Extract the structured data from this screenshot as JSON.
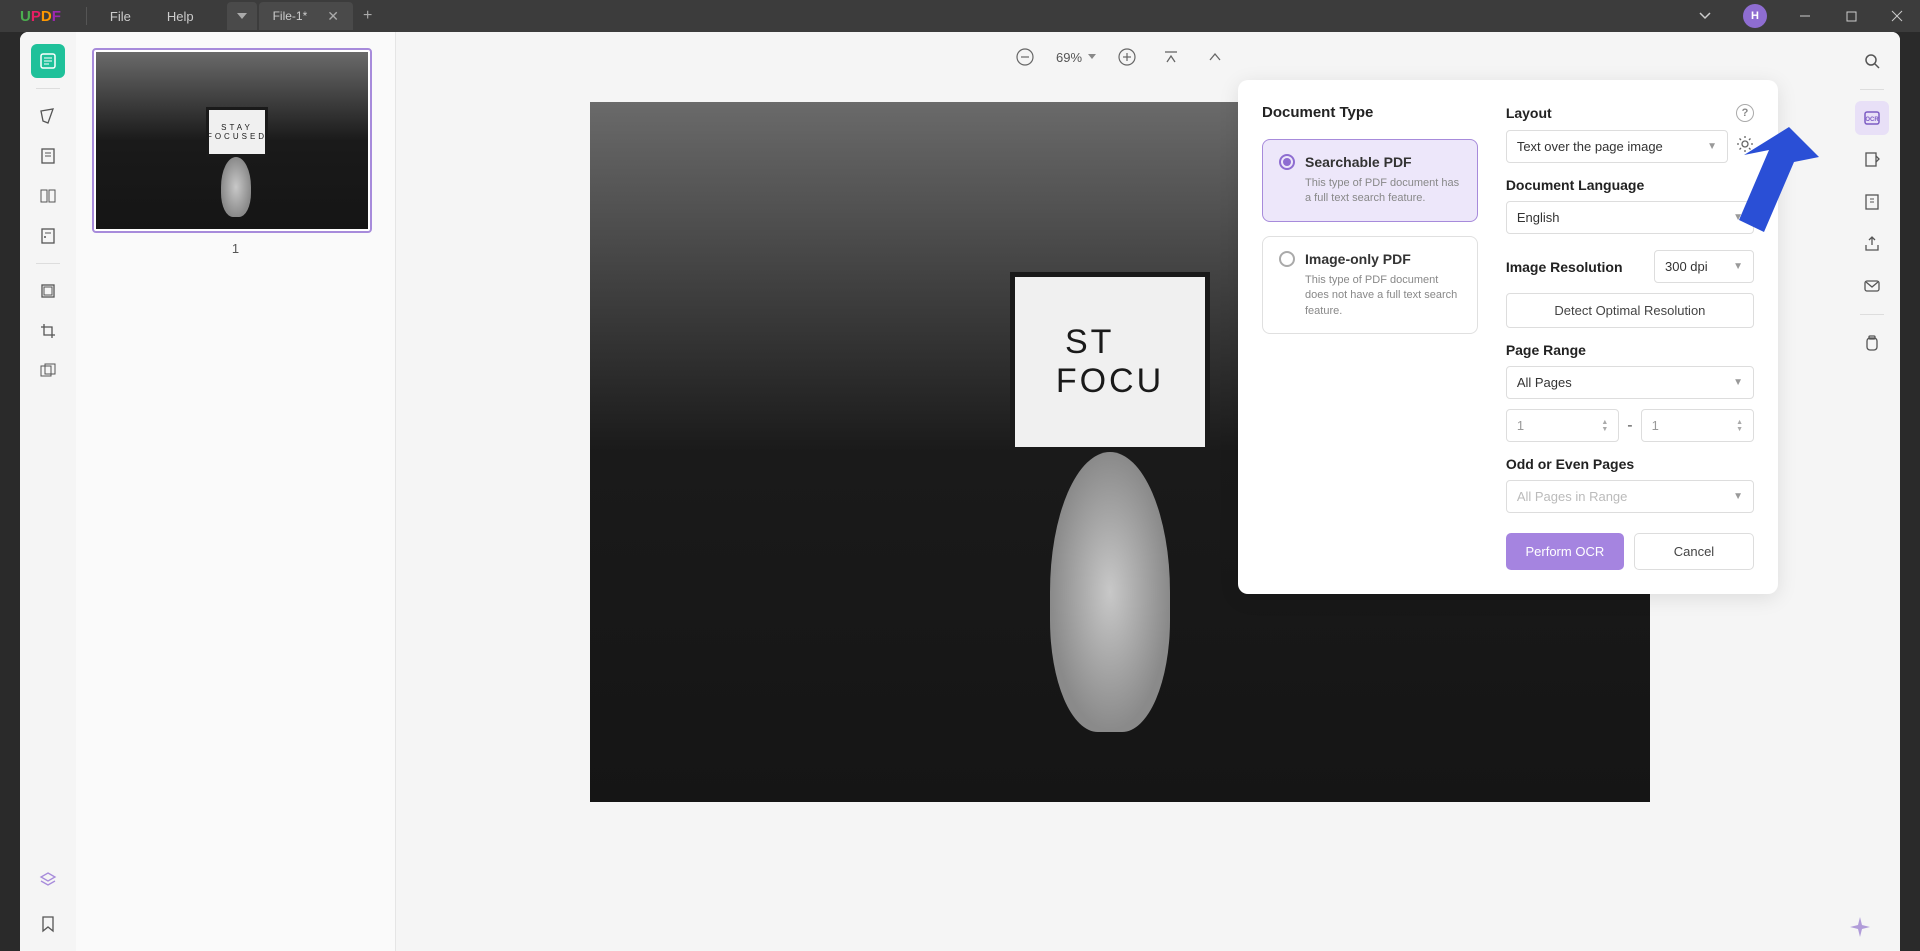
{
  "app": {
    "name": "UPDF"
  },
  "menu": {
    "file": "File",
    "help": "Help"
  },
  "tab": {
    "name": "File-1*"
  },
  "avatar": {
    "initial": "H"
  },
  "zoom": {
    "value": "69%"
  },
  "thumbnail": {
    "page_number": "1"
  },
  "page_content": {
    "line1": "STAY",
    "line2": "FOCUSED",
    "canvas_line1": "ST",
    "canvas_line2": "FOCU"
  },
  "ocr": {
    "document_type": {
      "title": "Document Type",
      "searchable": {
        "title": "Searchable PDF",
        "desc": "This type of PDF document has a full text search feature."
      },
      "imageonly": {
        "title": "Image-only PDF",
        "desc": "This type of PDF document does not have a full text search feature."
      }
    },
    "layout": {
      "label": "Layout",
      "value": "Text over the page image"
    },
    "language": {
      "label": "Document Language",
      "value": "English"
    },
    "resolution": {
      "label": "Image Resolution",
      "value": "300 dpi",
      "detect": "Detect Optimal Resolution"
    },
    "page_range": {
      "label": "Page Range",
      "value": "All Pages",
      "from": "1",
      "to": "1"
    },
    "odd_even": {
      "label": "Odd or Even Pages",
      "value": "All Pages in Range"
    },
    "buttons": {
      "perform": "Perform OCR",
      "cancel": "Cancel"
    }
  }
}
